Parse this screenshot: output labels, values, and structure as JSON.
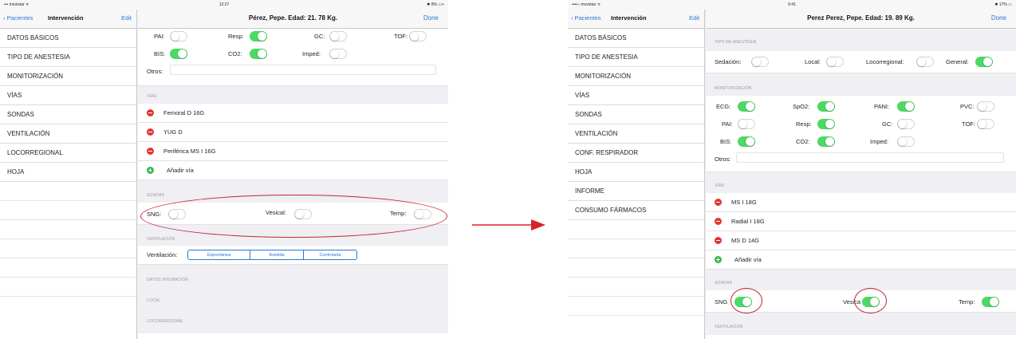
{
  "left": {
    "status": {
      "carrier": "••• movistar ᯤ",
      "time": "12:27",
      "battery": "✱ 8% ▭+"
    },
    "sidebar": {
      "back": "Pacientes",
      "title": "Intervención",
      "edit": "Edit",
      "items": [
        "DATOS BÁSICOS",
        "TIPO DE ANESTESIA",
        "MONITORIZACIÓN",
        "VÍAS",
        "SONDAS",
        "VENTILACIÓN",
        "LOCORREGIONAL",
        "HOJA"
      ]
    },
    "header": {
      "title": "Pérez, Pepe. Edad: 21. 78 Kg.",
      "done": "Done"
    },
    "monitor": {
      "pai": "PAI:",
      "resp": "Resp:",
      "gc": "GC:",
      "tof": "TOF:",
      "bis": "BIS:",
      "co2": "CO2:",
      "imped": "Imped:",
      "otros": "Otros:"
    },
    "vias": {
      "section": "VÍAS",
      "items": [
        "Femoral D 16G",
        "YUG D",
        "Periférica MS I 16G"
      ],
      "add": "Añadir vía"
    },
    "sondas": {
      "section": "SONDAS",
      "sng": "SNG:",
      "vesical": "Vesical:",
      "temp": "Temp:"
    },
    "ventilacion": {
      "section": "VENTILACIÓN",
      "label": "Ventilación:",
      "options": [
        "Espontánea",
        "Asistida",
        "Controlada"
      ]
    },
    "sections2": [
      "DATOS INTUBACIÓN",
      "LOCAL",
      "LOCORREGIONAL"
    ]
  },
  "right": {
    "status": {
      "carrier": "••••○ movistar ᯤ",
      "time": "9:41",
      "battery": "✱ 17% ▭"
    },
    "sidebar": {
      "back": "Pacientes",
      "title": "Intervención",
      "edit": "Edit",
      "items": [
        "DATOS BÁSICOS",
        "TIPO DE ANESTESIA",
        "MONITORIZACIÓN",
        "VÍAS",
        "SONDAS",
        "VENTILACIÓN",
        "CONF. RESPIRADOR",
        "HOJA",
        "INFORME",
        "CONSUMO FÁRMACOS"
      ]
    },
    "header": {
      "title": "Perez Perez, Pepe. Edad: 19. 89 Kg.",
      "done": "Done"
    },
    "anestesia": {
      "section": "TIPO DE ANESTESIA",
      "sedacion": "Sedación:",
      "local": "Local:",
      "locorregional": "Locorregional:",
      "general": "General:"
    },
    "monitor": {
      "section": "MONITORIZACIÓN",
      "ecg": "ECG:",
      "spo2": "SpO2:",
      "pani": "PANI:",
      "pvc": "PVC:",
      "pai": "PAI:",
      "resp": "Resp:",
      "gc": "GC:",
      "tof": "TOF:",
      "bis": "BIS:",
      "co2": "CO2:",
      "imped": "Imped:",
      "otros": "Otros:"
    },
    "vias": {
      "section": "VÍAS",
      "items": [
        "MS I 18G",
        "Radial I 18G",
        "MS D 14G"
      ],
      "add": "Añadir vía"
    },
    "sondas": {
      "section": "SONDAS",
      "sng": "SNG",
      "vesical": "Vesica",
      "temp": "Temp:"
    },
    "ventilacion": {
      "section": "VENTILACIÓN"
    }
  },
  "colors": {
    "accent": "#2b78d8",
    "toggle_on": "#4cd964",
    "remove": "#e3342f",
    "add": "#38b44a",
    "highlight": "#c4262e"
  }
}
